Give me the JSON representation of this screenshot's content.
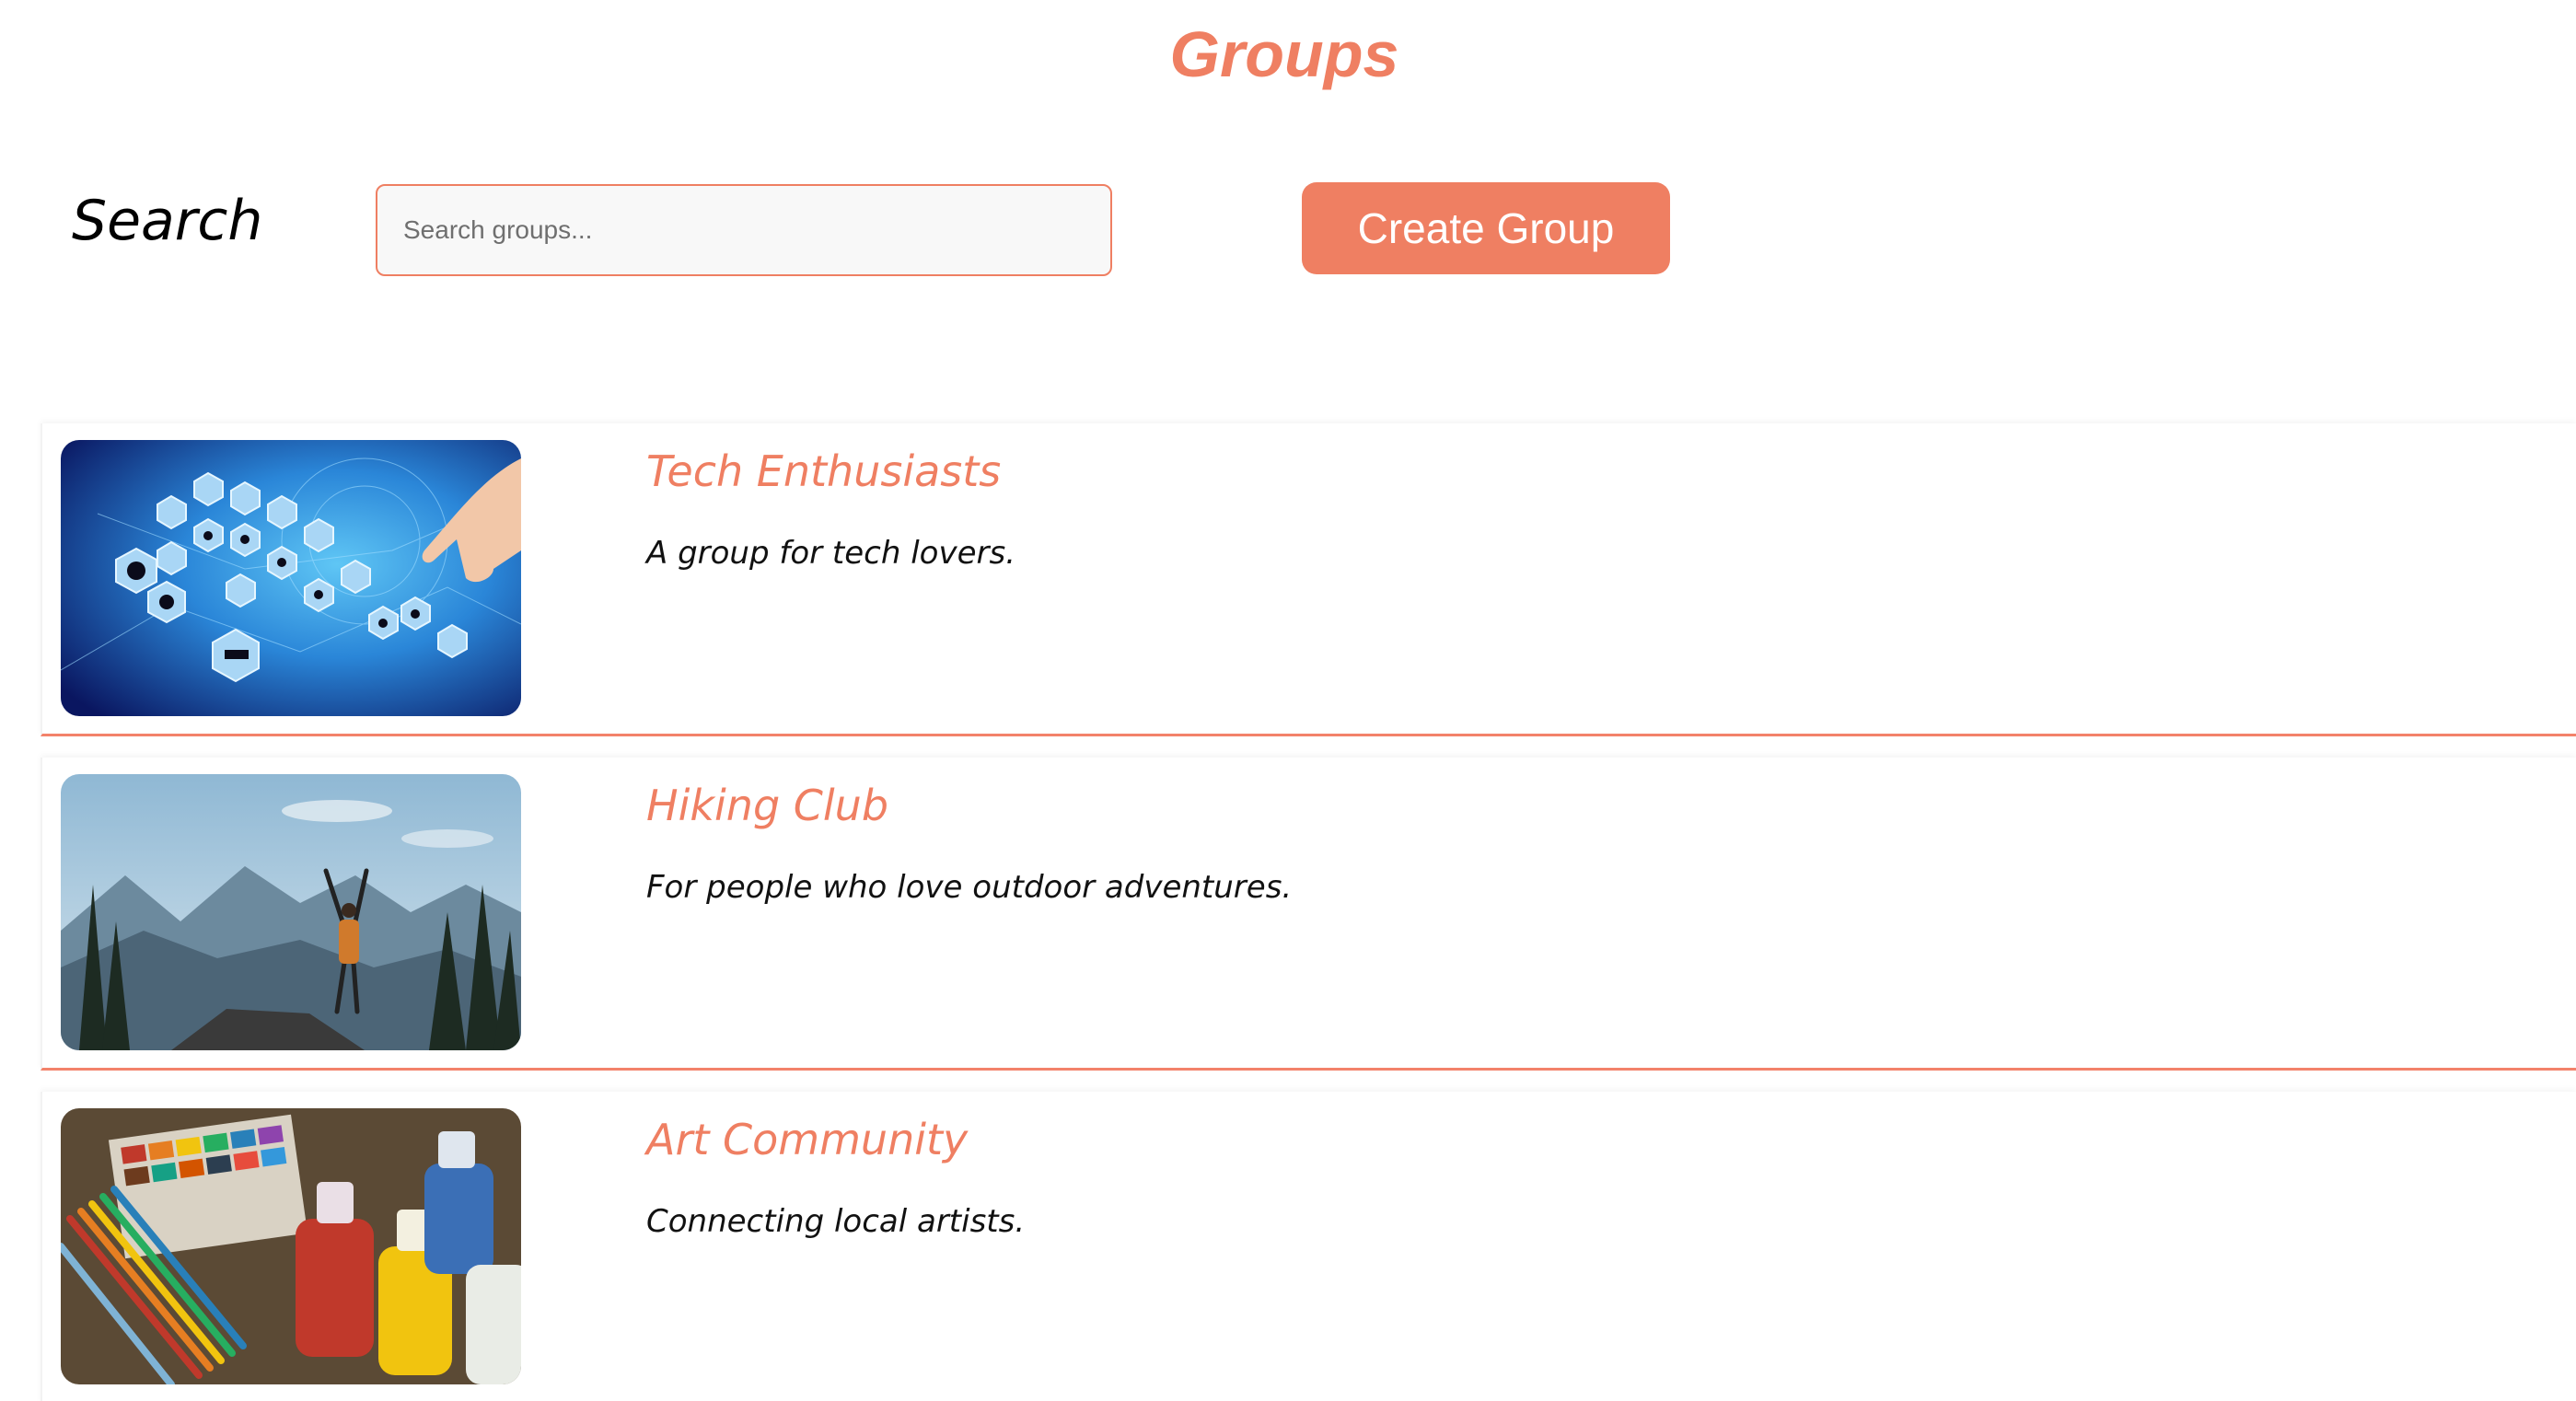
{
  "page": {
    "title": "Groups"
  },
  "search": {
    "label": "Search",
    "placeholder": "Search groups...",
    "value": ""
  },
  "actions": {
    "create_label": "Create Group"
  },
  "groups": [
    {
      "name": "Tech Enthusiasts",
      "description": "A group for tech lovers.",
      "image": "technology-hexagon-icons-image"
    },
    {
      "name": "Hiking Club",
      "description": "For people who love outdoor adventures.",
      "image": "mountain-hiker-image"
    },
    {
      "name": "Art Community",
      "description": "Connecting local artists.",
      "image": "paint-bottles-and-pencils-image"
    }
  ],
  "colors": {
    "accent": "#ef7f62",
    "divider": "#f3826a",
    "input_bg": "#f8f8f8"
  }
}
